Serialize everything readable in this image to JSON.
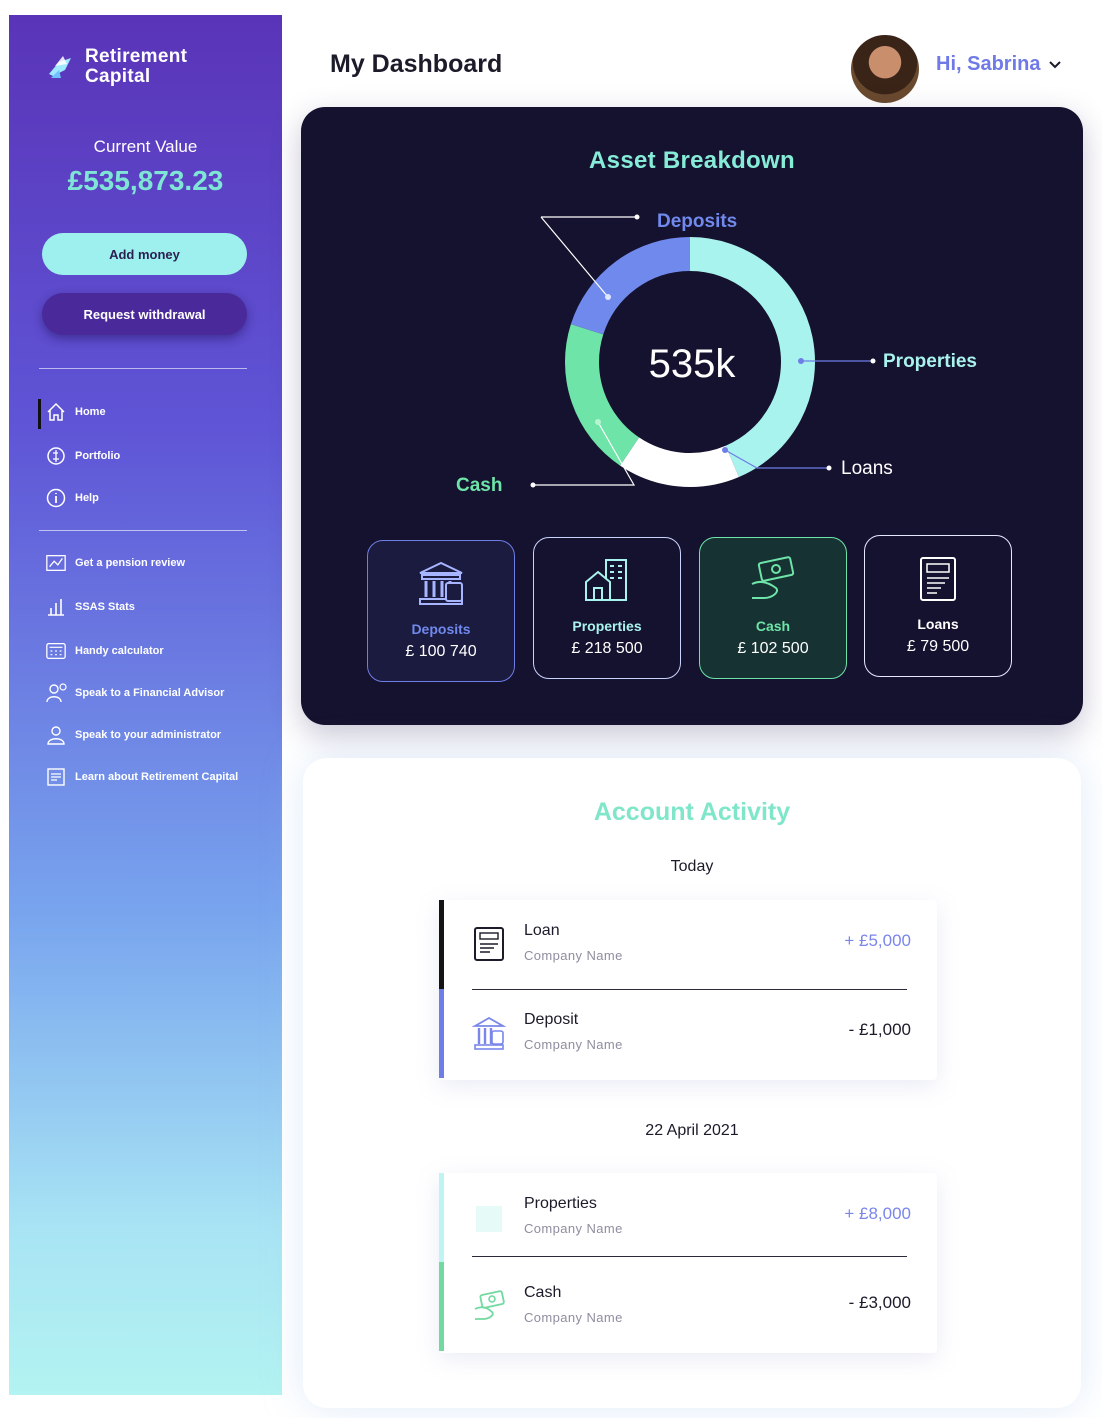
{
  "brand": {
    "name_line1": "Retirement",
    "name_line2": "Capital"
  },
  "sidebar": {
    "current_value_label": "Current Value",
    "current_value": "£535,873.23",
    "add_money_label": "Add money",
    "withdraw_label": "Request withdrawal",
    "nav": [
      {
        "label": "Home",
        "icon": "home-icon"
      },
      {
        "label": "Portfolio",
        "icon": "portfolio-icon"
      },
      {
        "label": "Help",
        "icon": "help-icon"
      }
    ],
    "links": [
      {
        "label": "Get a pension review",
        "icon": "pension-review-icon"
      },
      {
        "label": "SSAS Stats",
        "icon": "stats-icon"
      },
      {
        "label": "Handy calculator",
        "icon": "calculator-icon"
      },
      {
        "label": "Speak to a Financial Advisor",
        "icon": "advisor-icon"
      },
      {
        "label": "Speak to your administrator",
        "icon": "administrator-icon"
      },
      {
        "label": "Learn about Retirement Capital",
        "icon": "learn-icon"
      }
    ]
  },
  "header": {
    "title": "My Dashboard",
    "greeting": "Hi, Sabrina"
  },
  "asset": {
    "title": "Asset Breakdown",
    "center_label": "535k",
    "labels": {
      "deposits": "Deposits",
      "properties": "Properties",
      "loans": "Loans",
      "cash": "Cash"
    },
    "tiles": [
      {
        "label": "Deposits",
        "value": "£ 100 740"
      },
      {
        "label": "Properties",
        "value": "£ 218 500"
      },
      {
        "label": "Cash",
        "value": "£ 102 500"
      },
      {
        "label": "Loans",
        "value": "£ 79 500"
      }
    ]
  },
  "chart_data": {
    "type": "pie",
    "categories": [
      "Properties",
      "Loans",
      "Cash",
      "Deposits"
    ],
    "values": [
      218500,
      79500,
      102500,
      100740
    ],
    "colors": [
      "#a9f3ee",
      "#ffffff",
      "#6ee4a8",
      "#7089ec"
    ]
  },
  "activity": {
    "title": "Account Activity",
    "groups": [
      {
        "date": "Today",
        "items": [
          {
            "name": "Loan",
            "company": "Company Name",
            "amount": "+ £5,000",
            "icon": "loan-icon",
            "bar_color": "#141414",
            "amount_color": "#7a86ea"
          },
          {
            "name": "Deposit",
            "company": "Company Name",
            "amount": "- £1,000",
            "icon": "deposit-icon",
            "bar_color": "#6f7de6",
            "amount_color": "#1b1b2a"
          }
        ]
      },
      {
        "date": "22 April 2021",
        "items": [
          {
            "name": "Properties",
            "company": "Company Name",
            "amount": "+ £8,000",
            "icon": "property-icon",
            "bar_color": "#bff4f4",
            "amount_color": "#7a86ea"
          },
          {
            "name": "Cash",
            "company": "Company Name",
            "amount": "- £3,000",
            "icon": "cash-icon",
            "bar_color": "#72d9a0",
            "amount_color": "#1b1b2a"
          }
        ]
      }
    ]
  }
}
